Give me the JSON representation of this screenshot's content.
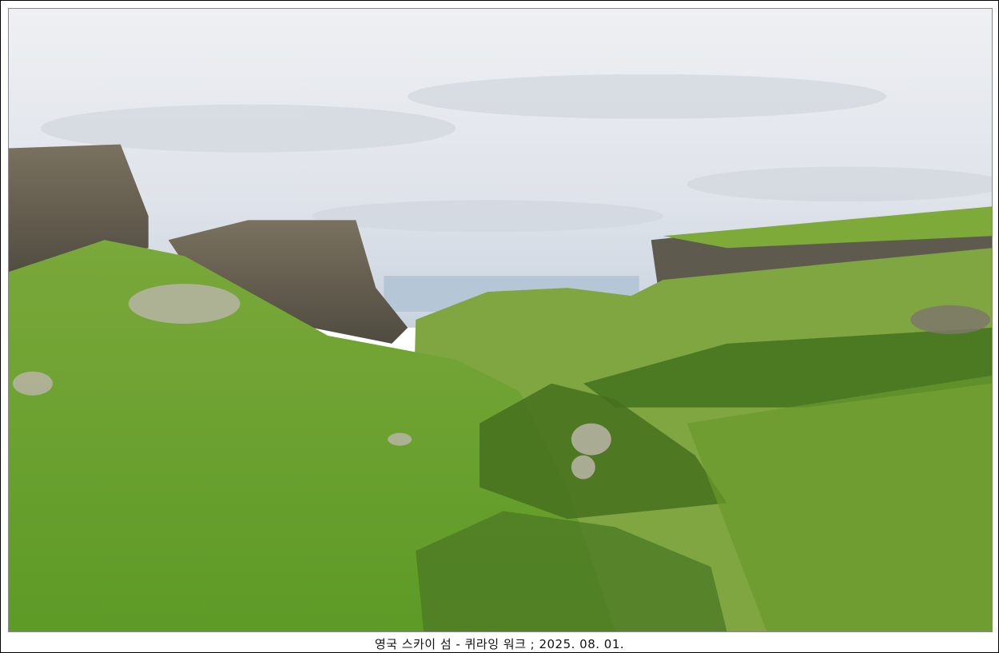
{
  "photo": {
    "subject": "Isle of Skye Quiraing landscape photo",
    "colors": {
      "sky": "#e6e9ee",
      "grass": "#6aa02c",
      "dark_grass": "#3f6a1e",
      "rock": "#6b6558",
      "sea": "#b8c8d8"
    }
  },
  "caption": "영국 스카이 섬 - 퀴라잉 워크 ; 2025. 08. 01."
}
